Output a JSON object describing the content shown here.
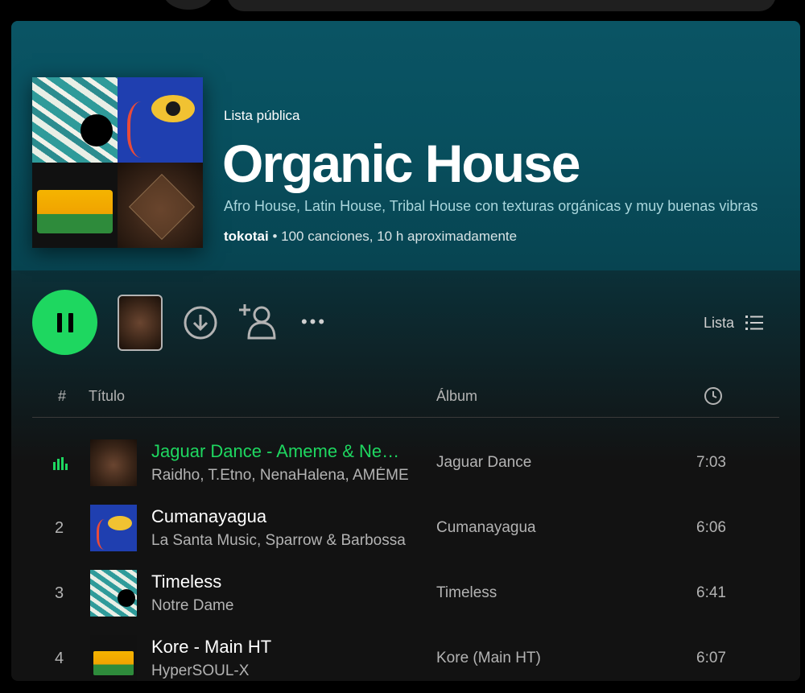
{
  "playlist": {
    "type_label": "Lista pública",
    "title": "Organic House",
    "description": "Afro House, Latin House, Tribal House con texturas orgánicas y muy buenas vibras",
    "owner": "tokotai",
    "stats": " • 100 canciones, 10 h aproximadamente"
  },
  "controls": {
    "view_label": "Lista",
    "more_label": "•••"
  },
  "table_header": {
    "number": "#",
    "title": "Título",
    "album": "Álbum"
  },
  "tracks": [
    {
      "number": "",
      "title": "Jaguar Dance - Ameme & NenaHalena Remix",
      "artist": "Raidho, T.Etno, NenaHalena, AMÉME",
      "album": "Jaguar Dance",
      "duration": "7:03",
      "playing": true
    },
    {
      "number": "2",
      "title": "Cumanayagua",
      "artist": "La Santa Music, Sparrow & Barbossa",
      "album": "Cumanayagua",
      "duration": "6:06",
      "playing": false
    },
    {
      "number": "3",
      "title": "Timeless",
      "artist": "Notre Dame",
      "album": "Timeless",
      "duration": "6:41",
      "playing": false
    },
    {
      "number": "4",
      "title": "Kore - Main HT",
      "artist": "HyperSOUL-X",
      "album": "Kore (Main HT)",
      "duration": "6:07",
      "playing": false
    }
  ],
  "colors": {
    "accent": "#1ed760",
    "hero": "#0a5464",
    "background": "#121212"
  },
  "icons": {
    "play_pause": "pause-icon",
    "download": "download-icon",
    "follow": "add-user-icon",
    "more": "more-icon",
    "view": "list-view-icon",
    "duration": "clock-icon",
    "now_playing": "equalizer-icon"
  }
}
